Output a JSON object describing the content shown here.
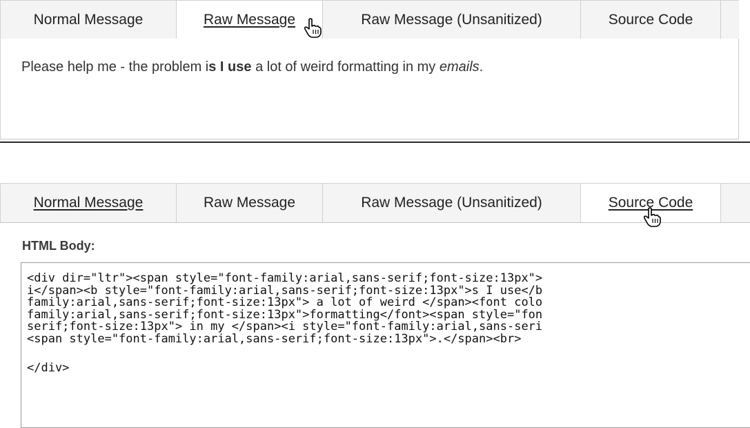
{
  "top_panel": {
    "tabs": [
      {
        "label": "Normal Message"
      },
      {
        "label": "Raw Message"
      },
      {
        "label": "Raw Message (Unsanitized)"
      },
      {
        "label": "Source Code"
      }
    ],
    "message": {
      "part1": "Please help me - the problem i",
      "part2": "s I use",
      "part3": " a lot of weird formatting in my ",
      "part4": "emails",
      "part5": "."
    }
  },
  "bottom_panel": {
    "tabs": [
      {
        "label": "Normal Message"
      },
      {
        "label": "Raw Message"
      },
      {
        "label": "Raw Message (Unsanitized)"
      },
      {
        "label": "Source Code"
      }
    ],
    "html_body_label": "HTML Body:",
    "code_lines": [
      "<div dir=\"ltr\"><span style=\"font-family:arial,sans-serif;font-size:13px\">",
      "i</span><b style=\"font-family:arial,sans-serif;font-size:13px\">s I use</b",
      "family:arial,sans-serif;font-size:13px\"> a lot of weird </span><font colo",
      "family:arial,sans-serif;font-size:13px\">formatting</font><span style=\"fon",
      "serif;font-size:13px\"> in my </span><i style=\"font-family:arial,sans-seri",
      "<span style=\"font-family:arial,sans-serif;font-size:13px\">.</span><br>"
    ],
    "code_end": "</div>"
  }
}
